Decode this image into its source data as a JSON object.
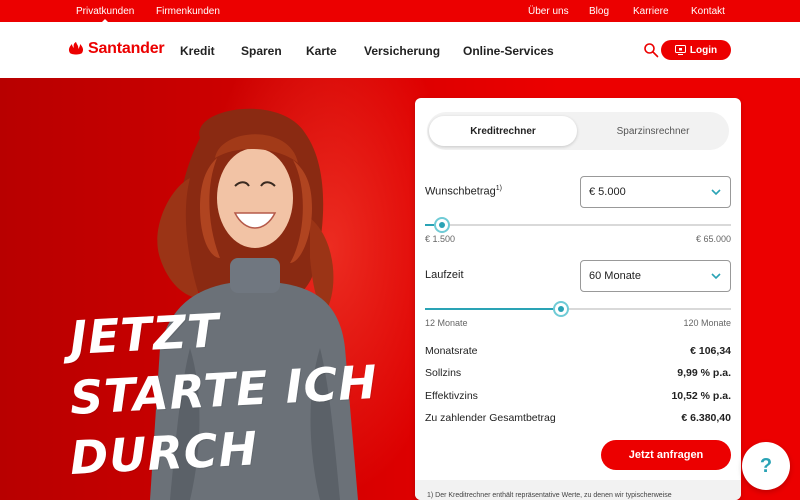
{
  "topbar": {
    "left": [
      "Privatkunden",
      "Firmenkunden"
    ],
    "right": [
      "Über uns",
      "Blog",
      "Karriere",
      "Kontakt"
    ]
  },
  "header": {
    "logo_text": "Santander",
    "nav": [
      "Kredit",
      "Sparen",
      "Karte",
      "Versicherung",
      "Online-Services"
    ],
    "search_icon": "search-icon",
    "login_label": "Login",
    "login_icon": "monitor-lock-icon"
  },
  "hero": {
    "headline": [
      "JETZT",
      "STARTE ICH",
      "DURCH"
    ]
  },
  "calculator": {
    "tabs": [
      "Kreditrechner",
      "Sparzinsrechner"
    ],
    "active_tab": "Kreditrechner",
    "amount": {
      "label": "Wunschbetrag",
      "footnote_mark": "1)",
      "value": "€ 5.000",
      "min_label": "€ 1.500",
      "max_label": "€ 65.000",
      "slider_fraction": 0.055
    },
    "duration": {
      "label": "Laufzeit",
      "value": "60 Monate",
      "min_label": "12 Monate",
      "max_label": "120 Monate",
      "slider_fraction": 0.444
    },
    "results": [
      {
        "label": "Monatsrate",
        "value": "€ 106,34"
      },
      {
        "label": "Sollzins",
        "value": "9,99 % p.a."
      },
      {
        "label": "Effektivzins",
        "value": "10,52 % p.a."
      },
      {
        "label": "Zu zahlender Gesamtbetrag",
        "value": "€ 6.380,40"
      }
    ],
    "cta_label": "Jetzt anfragen",
    "footnote": "1) Der Kreditrechner enthält repräsentative Werte, zu denen wir typischerweise"
  },
  "help": {
    "label": "?"
  },
  "colors": {
    "brand": "#ec0000",
    "accent": "#2aa3b5"
  }
}
